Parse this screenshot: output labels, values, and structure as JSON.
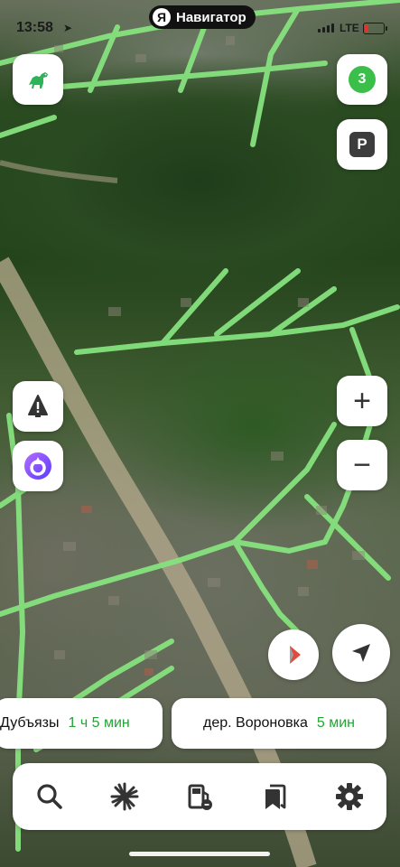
{
  "status_bar": {
    "time": "13:58",
    "location_arrow": "➤",
    "network": "LTE",
    "battery_color": "#e0332b"
  },
  "app": {
    "logo_letter": "Я",
    "title": "Навигатор"
  },
  "map_controls": {
    "dino_icon": "dino-icon",
    "traffic_level": "3",
    "traffic_color": "#3cbf4a",
    "parking_label": "P",
    "zoom_in": "+",
    "zoom_out": "−",
    "alert_icon": "alert-icon",
    "alice_icon": "alice-icon",
    "compass_icon": "compass-icon",
    "locate_icon": "navigation-arrow-icon"
  },
  "routes": [
    {
      "destination": "Дубъязы",
      "duration": "1 ч 5 мин"
    },
    {
      "destination": "дер. Вороновка",
      "duration": "5 мин"
    }
  ],
  "toolbar": {
    "items": [
      "search-icon",
      "discovery-icon",
      "fuel-icon",
      "bookmarks-icon",
      "settings-icon"
    ]
  },
  "colors": {
    "duration_green": "#23a435",
    "road_green": "#86e27e"
  }
}
